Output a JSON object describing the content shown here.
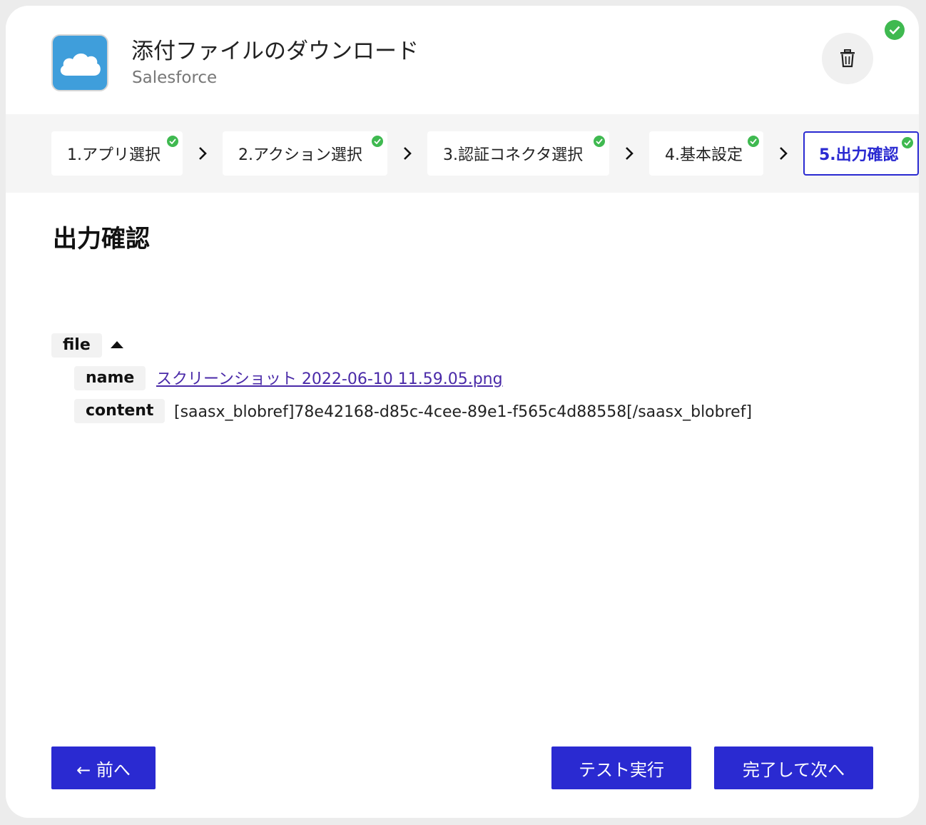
{
  "header": {
    "title": "添付ファイルのダウンロード",
    "subtitle": "Salesforce",
    "app_icon": "cloud-icon",
    "delete_icon": "trash-icon",
    "status_icon": "check-circle-icon"
  },
  "steps": [
    {
      "label": "1.アプリ選択",
      "done": true
    },
    {
      "label": "2.アクション選択",
      "done": true
    },
    {
      "label": "3.認証コネクタ選択",
      "done": true
    },
    {
      "label": "4.基本設定",
      "done": true
    },
    {
      "label": "5.出力確認",
      "done": true,
      "active": true
    }
  ],
  "section_title": "出力確認",
  "output": {
    "root_key": "file",
    "fields": [
      {
        "key": "name",
        "value": "スクリーンショット 2022-06-10 11.59.05.png",
        "link": true
      },
      {
        "key": "content",
        "value": "[saasx_blobref]78e42168-d85c-4cee-89e1-f565c4d88558[/saasx_blobref]",
        "link": false
      }
    ]
  },
  "footer": {
    "prev_label": "← 前へ",
    "test_label": "テスト実行",
    "finish_label": "完了して次へ"
  },
  "colors": {
    "accent": "#2a2ad1",
    "success": "#3fb950",
    "app_icon_bg": "#3f9edb",
    "link": "#4a2aa8"
  }
}
